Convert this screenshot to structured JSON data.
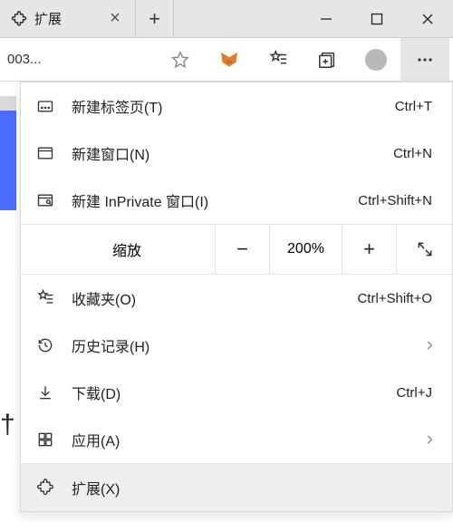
{
  "titlebar": {
    "tab_title": "扩展"
  },
  "toolbar": {
    "address_text": "003..."
  },
  "menu": {
    "new_tab": {
      "label": "新建标签页(T)",
      "shortcut": "Ctrl+T"
    },
    "new_window": {
      "label": "新建窗口(N)",
      "shortcut": "Ctrl+N"
    },
    "new_inprivate": {
      "label": "新建 InPrivate 窗口(I)",
      "shortcut": "Ctrl+Shift+N"
    },
    "zoom": {
      "label": "缩放",
      "value": "200%"
    },
    "favorites": {
      "label": "收藏夹(O)",
      "shortcut": "Ctrl+Shift+O"
    },
    "history": {
      "label": "历史记录(H)"
    },
    "downloads": {
      "label": "下载(D)",
      "shortcut": "Ctrl+J"
    },
    "apps": {
      "label": "应用(A)"
    },
    "extensions": {
      "label": "扩展(X)"
    }
  },
  "fragment": "†"
}
